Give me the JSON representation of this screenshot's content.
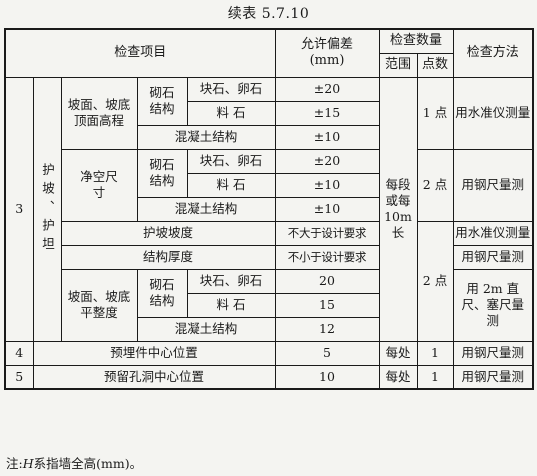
{
  "caption": "续表 5.7.10",
  "header": {
    "item": "检查项目",
    "tolerance_line1": "允许偏差",
    "tolerance_line2": "(mm)",
    "quantity": "检查数量",
    "scope": "范围",
    "points": "点数",
    "method": "检查方法"
  },
  "group3": {
    "no": "3",
    "name": "护坡、护坦",
    "slope_top_elev": "坡面、坡底顶面高程",
    "clear_size": "净空尺寸",
    "slope_flatness": "坡面、坡底平整度",
    "rubble_structure": "砌石结构",
    "block_pebble": "块石、卵石",
    "dressed_stone": "料 石",
    "concrete_structure": "混凝土结构",
    "slope_gradient": "护坡坡度",
    "structure_thickness": "结构厚度",
    "tol_pm20": "±20",
    "tol_pm15": "±15",
    "tol_pm10": "±10",
    "tol_not_more": "不大于设计要求",
    "tol_not_less": "不小于设计要求",
    "tol_20": "20",
    "tol_15": "15",
    "tol_12": "12",
    "scope_text": "每段或每10m长",
    "points_1": "1 点",
    "points_2a": "2 点",
    "points_2b": "2 点",
    "method_level": "用水准仪测量",
    "method_ruler": "用钢尺量测",
    "method_ruler2": "用钢尺量测",
    "method_level2": "用水准仪测量",
    "method_ruler3": "用钢尺量测",
    "method_straightedge": "用 2m 直尺、塞尺量测"
  },
  "row4": {
    "no": "4",
    "item": "预埋件中心位置",
    "tol": "5",
    "scope": "每处",
    "points": "1",
    "method": "用钢尺量测"
  },
  "row5": {
    "no": "5",
    "item": "预留孔洞中心位置",
    "tol": "10",
    "scope": "每处",
    "points": "1",
    "method": "用钢尺量测"
  },
  "note": {
    "prefix": "注:",
    "symbol": "H",
    "text": "系指墙全高(mm)。"
  }
}
